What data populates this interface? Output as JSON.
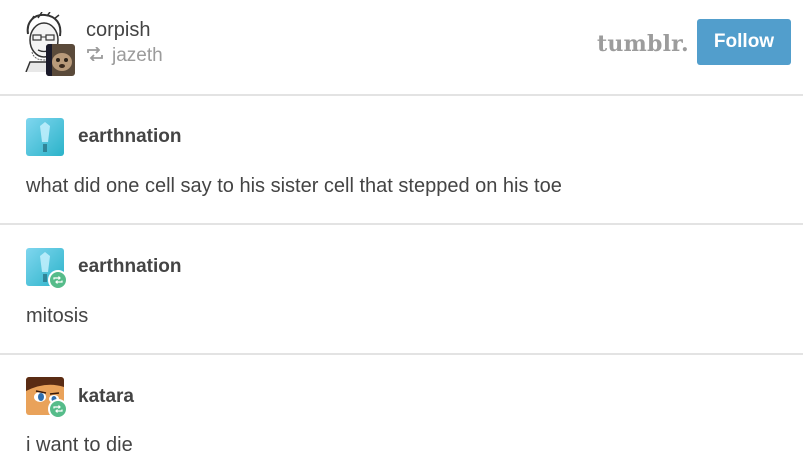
{
  "header": {
    "username": "corpish",
    "reblogged_from": "jazeth",
    "brand_wordmark": "tumblr.",
    "follow_label": "Follow",
    "colors": {
      "follow_button": "#529ecc",
      "reblog_badge": "#56bc8a",
      "divider": "#e3e3e3"
    }
  },
  "posts": [
    {
      "name": "earthnation",
      "text": "what did one cell say to his sister cell that stepped on his toe",
      "avatar": "crystal-avatar",
      "reblog_badge": false
    },
    {
      "name": "earthnation",
      "text": "mitosis",
      "avatar": "crystal-avatar",
      "reblog_badge": true
    },
    {
      "name": "katara",
      "text": "i want to die",
      "avatar": "katara-avatar",
      "reblog_badge": true
    }
  ]
}
